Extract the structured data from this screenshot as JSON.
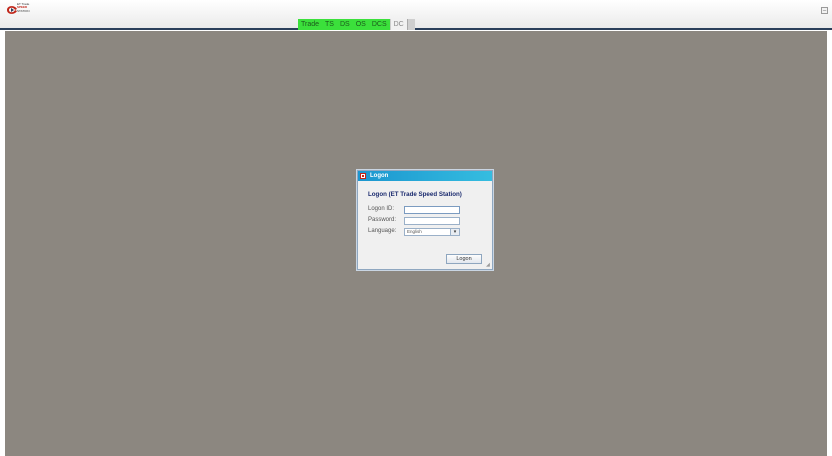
{
  "app": {
    "logo": {
      "line1": "ET Trade",
      "line2": "SPEED",
      "line3": "STATION"
    },
    "window_button_glyph": "–"
  },
  "status_strip": [
    {
      "label": "Trade",
      "state": "on"
    },
    {
      "label": "TS",
      "state": "on"
    },
    {
      "label": "DS",
      "state": "on"
    },
    {
      "label": "OS",
      "state": "on"
    },
    {
      "label": "DCS",
      "state": "on"
    },
    {
      "label": "DC",
      "state": "off"
    }
  ],
  "dialog": {
    "title": "Logon",
    "heading": "Logon (ET Trade Speed Station)",
    "logon_id_label": "Logon ID:",
    "logon_id_value": "",
    "password_label": "Password:",
    "password_value": "",
    "language_label": "Language:",
    "language_value": "English",
    "logon_button": "Logon"
  },
  "colors": {
    "desktop": "#8c8780",
    "status_on": "#3be03b",
    "titlebar": "#1b96cf"
  }
}
